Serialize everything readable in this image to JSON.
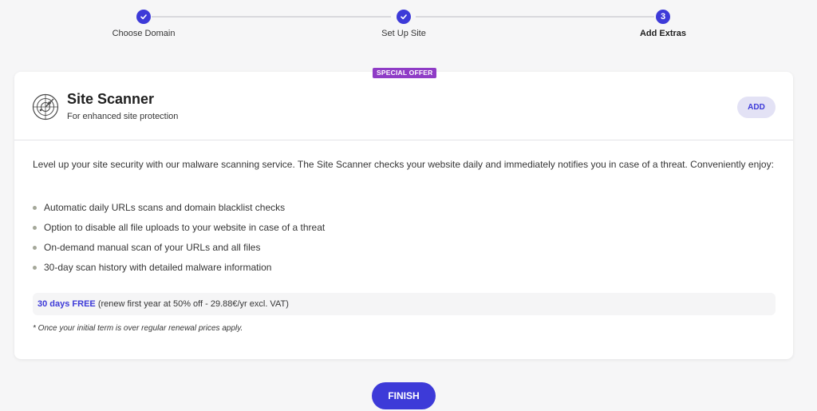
{
  "stepper": {
    "steps": [
      {
        "label": "Choose Domain",
        "state": "complete",
        "icon": "check-icon"
      },
      {
        "label": "Set Up Site",
        "state": "complete",
        "icon": "check-icon"
      },
      {
        "label": "Add Extras",
        "state": "active",
        "number": "3"
      }
    ]
  },
  "card": {
    "badge": "SPECIAL OFFER",
    "icon": "radar-icon",
    "title": "Site Scanner",
    "subtitle": "For enhanced site protection",
    "add_label": "ADD",
    "description": "Level up your site security with our malware scanning service. The Site Scanner checks your website daily and immediately notifies you in case of a threat. Conveniently enjoy:",
    "features": [
      "Automatic daily URLs scans and domain blacklist checks",
      "Option to disable all file uploads to your website in case of a threat",
      "On-demand manual scan of your URLs and all files",
      "30-day scan history with detailed malware information"
    ],
    "price_free": "30 days FREE",
    "price_detail": " (renew first year at 50% off - 29.88€/yr excl. VAT)",
    "footnote": "*  Once your initial term is over regular renewal prices apply."
  },
  "finish_label": "FINISH",
  "colors": {
    "accent": "#3d3ad8",
    "badge": "#8f3cc6",
    "add_button_bg": "#e3e2f5",
    "background": "#f6f6f7"
  }
}
